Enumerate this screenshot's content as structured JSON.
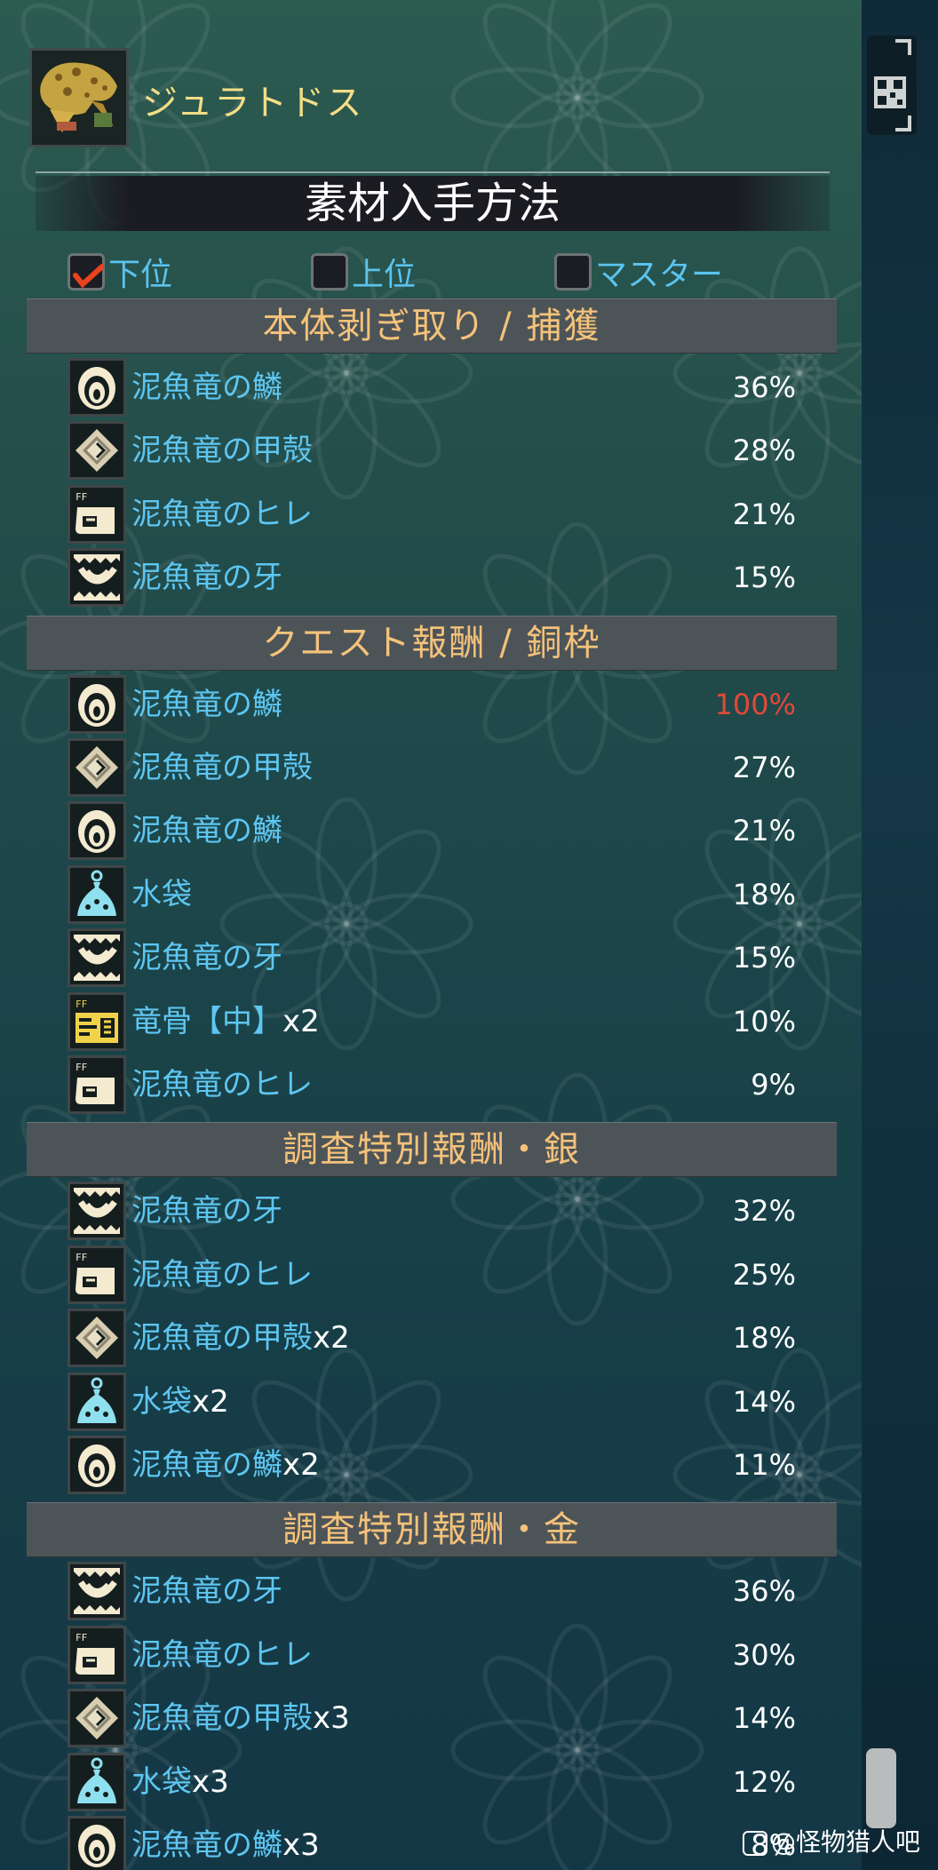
{
  "monster": {
    "name": "ジュラトドス"
  },
  "page_title": "素材入手方法",
  "filters": [
    {
      "label": "下位",
      "checked": true
    },
    {
      "label": "上位",
      "checked": false
    },
    {
      "label": "マスター",
      "checked": false
    }
  ],
  "sections": [
    {
      "title": "本体剥ぎ取り / 捕獲",
      "items": [
        {
          "icon": "scale-icon",
          "name": "泥魚竜の鱗",
          "qty": "",
          "pct": "36%"
        },
        {
          "icon": "shell-icon",
          "name": "泥魚竜の甲殻",
          "qty": "",
          "pct": "28%"
        },
        {
          "icon": "fin-icon",
          "name": "泥魚竜のヒレ",
          "qty": "",
          "pct": "21%"
        },
        {
          "icon": "fang-icon",
          "name": "泥魚竜の牙",
          "qty": "",
          "pct": "15%"
        }
      ]
    },
    {
      "title": "クエスト報酬 / 銅枠",
      "items": [
        {
          "icon": "scale-icon",
          "name": "泥魚竜の鱗",
          "qty": "",
          "pct": "100%"
        },
        {
          "icon": "shell-icon",
          "name": "泥魚竜の甲殻",
          "qty": "",
          "pct": "27%"
        },
        {
          "icon": "scale-icon",
          "name": "泥魚竜の鱗",
          "qty": "",
          "pct": "21%"
        },
        {
          "icon": "water-sac-icon",
          "name": "水袋",
          "qty": "",
          "pct": "18%"
        },
        {
          "icon": "fang-icon",
          "name": "泥魚竜の牙",
          "qty": "",
          "pct": "15%"
        },
        {
          "icon": "bone-icon",
          "name": "竜骨【中】",
          "qty": "x2",
          "pct": "10%"
        },
        {
          "icon": "fin-icon",
          "name": "泥魚竜のヒレ",
          "qty": "",
          "pct": "9%"
        }
      ]
    },
    {
      "title": "調査特別報酬・銀",
      "items": [
        {
          "icon": "fang-icon",
          "name": "泥魚竜の牙",
          "qty": "",
          "pct": "32%"
        },
        {
          "icon": "fin-icon",
          "name": "泥魚竜のヒレ",
          "qty": "",
          "pct": "25%"
        },
        {
          "icon": "shell-icon",
          "name": "泥魚竜の甲殻",
          "qty": "x2",
          "pct": "18%"
        },
        {
          "icon": "water-sac-icon",
          "name": "水袋",
          "qty": "x2",
          "pct": "14%"
        },
        {
          "icon": "scale-icon",
          "name": "泥魚竜の鱗",
          "qty": "x2",
          "pct": "11%"
        }
      ]
    },
    {
      "title": "調査特別報酬・金",
      "items": [
        {
          "icon": "fang-icon",
          "name": "泥魚竜の牙",
          "qty": "",
          "pct": "36%"
        },
        {
          "icon": "fin-icon",
          "name": "泥魚竜のヒレ",
          "qty": "",
          "pct": "30%"
        },
        {
          "icon": "shell-icon",
          "name": "泥魚竜の甲殻",
          "qty": "x3",
          "pct": "14%"
        },
        {
          "icon": "water-sac-icon",
          "name": "水袋",
          "qty": "x3",
          "pct": "12%"
        },
        {
          "icon": "scale-icon",
          "name": "泥魚竜の鱗",
          "qty": "x3",
          "pct": "8%"
        }
      ]
    }
  ],
  "watermark": {
    "text": "@怪物猎人吧"
  },
  "colors": {
    "item_name": "#5ec6f2",
    "section_title": "#f4c27a",
    "monster_name": "#f4dd86",
    "highlight_pct": "#e24838"
  }
}
